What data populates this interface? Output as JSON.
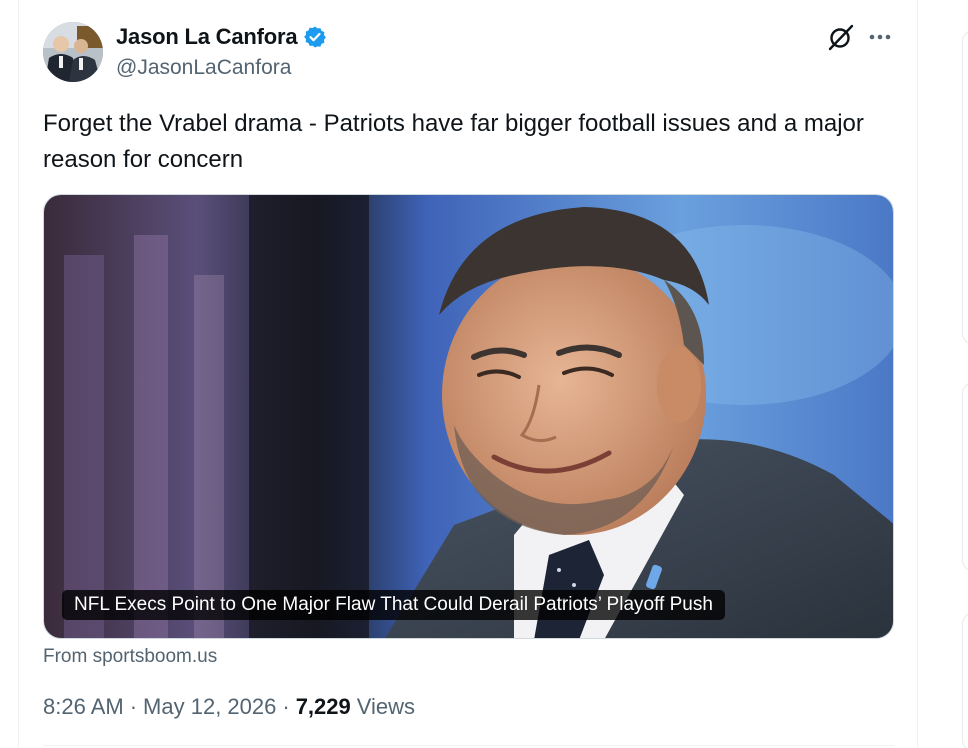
{
  "author": {
    "display_name": "Jason La Canfora",
    "handle": "@JasonLaCanfora",
    "verified": true,
    "avatar_icon": "profile-photo"
  },
  "actions": {
    "grok_icon": "grok-icon",
    "more_icon": "more-horizontal-icon"
  },
  "tweet": {
    "text": "Forget the Vrabel drama - Patriots have far bigger football issues and a major reason for concern"
  },
  "card": {
    "title": "NFL Execs Point to One Major Flaw That Could Derail Patriots’ Playoff Push",
    "source": "From sportsboom.us"
  },
  "meta": {
    "time": "8:26 AM",
    "separator": "·",
    "date": "May 12, 2026",
    "views_count": "7,229",
    "views_label": "Views"
  },
  "colors": {
    "verified_blue": "#1d9bf0",
    "secondary_text": "#536471",
    "primary_text": "#0f1419"
  }
}
